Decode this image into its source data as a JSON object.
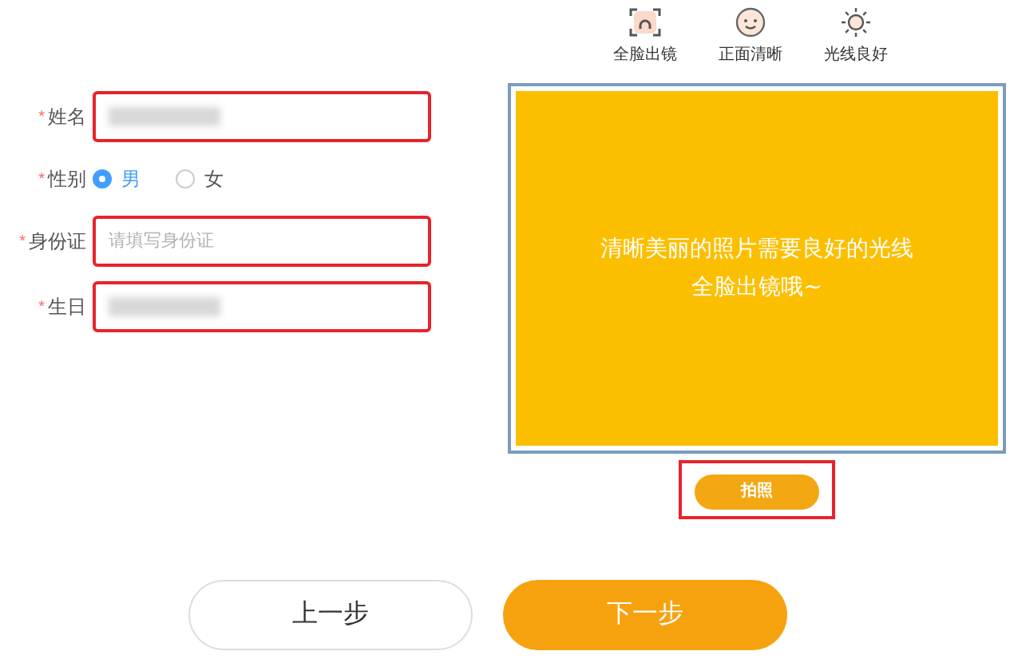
{
  "form": {
    "fields": [
      {
        "kind": "text",
        "label": "姓名",
        "required_mark": "*",
        "highlighted": true,
        "value_blurred": true
      },
      {
        "kind": "radio",
        "label": "性别",
        "required_mark": "*",
        "options": [
          {
            "label": "男",
            "selected": true
          },
          {
            "label": "女",
            "selected": false
          }
        ]
      },
      {
        "kind": "text",
        "label": "身份证",
        "required_mark": "*",
        "highlighted": true,
        "placeholder": "请填写身份证"
      },
      {
        "kind": "text",
        "label": "生日",
        "required_mark": "*",
        "highlighted": true,
        "value_blurred": true
      }
    ]
  },
  "photo_tips": [
    {
      "kind": "face-frame",
      "label": "全脸出镜"
    },
    {
      "kind": "smile",
      "label": "正面清晰"
    },
    {
      "kind": "sun",
      "label": "光线良好"
    }
  ],
  "camera": {
    "message": [
      "清晰美丽的照片需要良好的光线",
      "全脸出镜哦~"
    ],
    "shoot_button": {
      "label": "拍照",
      "highlighted": true
    }
  },
  "buttons": [
    {
      "label": "上一步",
      "kind": "secondary"
    },
    {
      "label": "下一步",
      "kind": "primary"
    }
  ]
}
